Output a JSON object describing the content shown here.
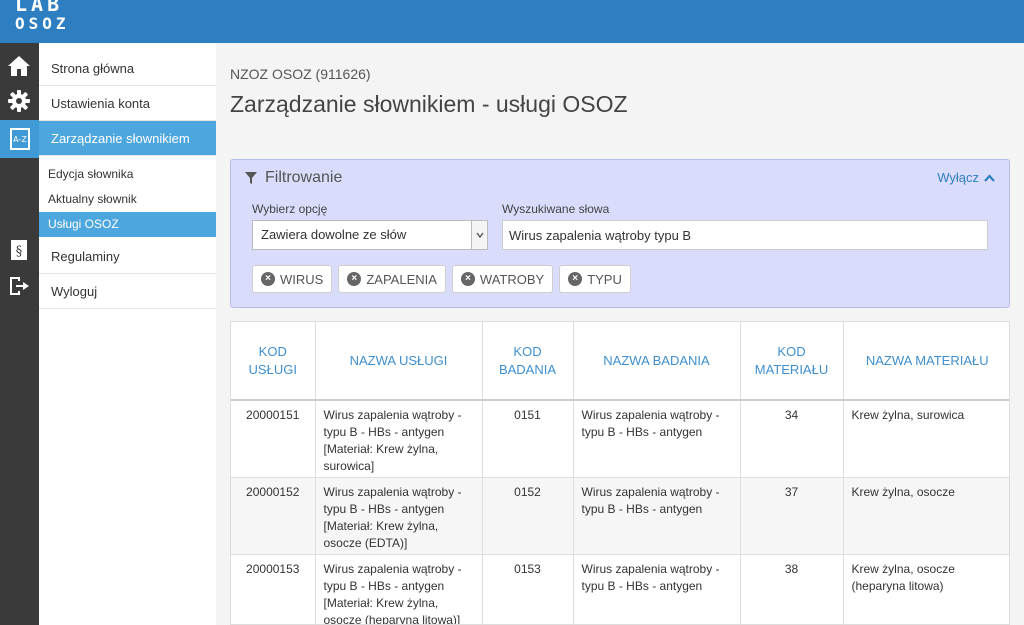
{
  "logo": {
    "top": "LAB",
    "bottom": "OSOZ"
  },
  "sidebar": {
    "items": [
      {
        "label": "Strona główna"
      },
      {
        "label": "Ustawienia konta"
      },
      {
        "label": "Zarządzanie słownikiem"
      }
    ],
    "subitems": [
      {
        "label": "Edycja słownika"
      },
      {
        "label": "Aktualny słownik"
      },
      {
        "label": "Usługi OSOZ"
      }
    ],
    "bottom_items": [
      {
        "label": "Regulaminy"
      },
      {
        "label": "Wyloguj"
      }
    ]
  },
  "main": {
    "org": "NZOZ OSOZ (911626)",
    "title": "Zarządzanie słownikiem - usługi OSOZ"
  },
  "filter": {
    "title": "Filtrowanie",
    "toggle_label": "Wyłącz",
    "option_label": "Wybierz opcję",
    "option_value": "Zawiera dowolne ze słów",
    "search_label": "Wyszukiwane słowa",
    "search_value": "Wirus zapalenia wątroby typu B",
    "tags": [
      "WIRUS",
      "ZAPALENIA",
      "WATROBY",
      "TYPU"
    ]
  },
  "table": {
    "headers": [
      "KOD USŁUGI",
      "NAZWA USŁUGI",
      "KOD BADANIA",
      "NAZWA BADANIA",
      "KOD MATERIAŁU",
      "NAZWA MATERIAŁU"
    ],
    "rows": [
      [
        "20000151",
        "Wirus zapalenia wątroby - typu B - HBs - antygen [Materiał: Krew żylna, surowica]",
        "0151",
        "Wirus zapalenia wątroby - typu B - HBs - antygen",
        "34",
        "Krew żylna, surowica"
      ],
      [
        "20000152",
        "Wirus zapalenia wątroby - typu B - HBs - antygen [Materiał: Krew żylna, osocze (EDTA)]",
        "0152",
        "Wirus zapalenia wątroby - typu B - HBs - antygen",
        "37",
        "Krew żylna, osocze"
      ],
      [
        "20000153",
        "Wirus zapalenia wątroby - typu B - HBs - antygen [Materiał: Krew żylna, osocze (heparyna litowa)]",
        "0153",
        "Wirus zapalenia wątroby - typu B - HBs - antygen",
        "38",
        "Krew żylna, osocze (heparyna litowa)"
      ]
    ]
  },
  "icons": [
    "home-icon",
    "gear-icon",
    "dictionary-az-icon",
    "regulations-paragraph-icon",
    "logout-icon",
    "filter-funnel-icon",
    "chevron-up-icon",
    "tag-remove-icon",
    "select-arrow-icon"
  ]
}
